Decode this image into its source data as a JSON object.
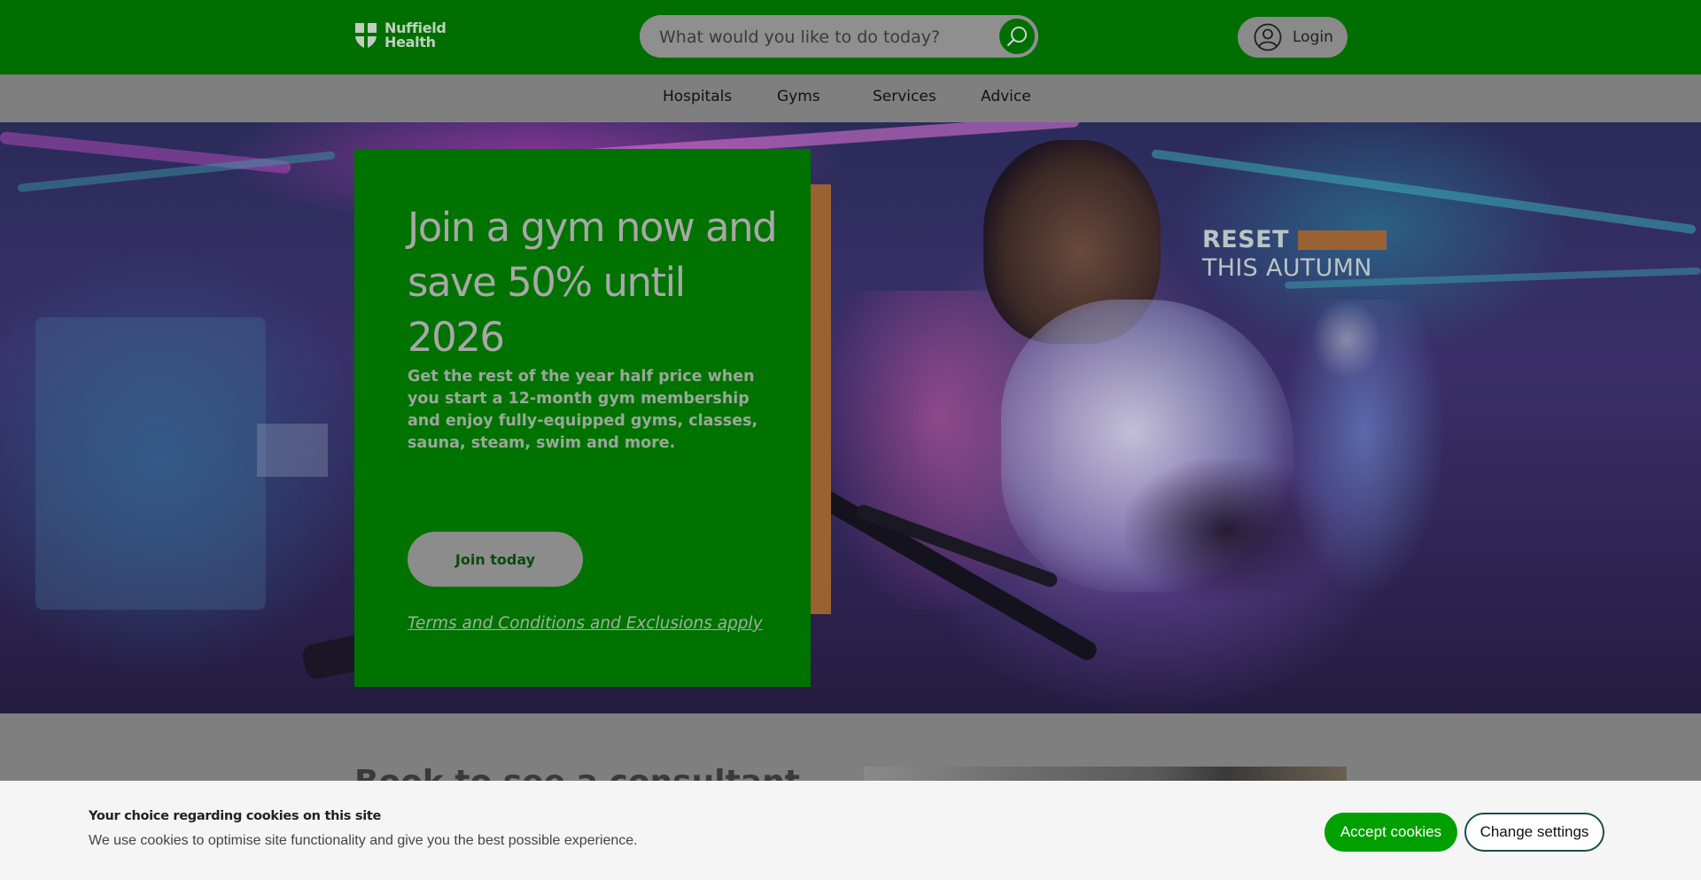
{
  "header": {
    "logo_text_line1": "Nuffield",
    "logo_text_line2": "Health",
    "search_placeholder": "What would you like to do today?",
    "login_label": "Login"
  },
  "nav": {
    "items": [
      {
        "label": "Hospitals"
      },
      {
        "label": "Gyms"
      },
      {
        "label": "Services"
      },
      {
        "label": "Advice"
      }
    ]
  },
  "hero": {
    "title": "Join a gym now and save 50% until 2026",
    "description": "Get the rest of the year half price when you start a 12-month gym membership and enjoy fully-equipped gyms, classes, sauna, steam, swim and more.",
    "cta_label": "Join today",
    "terms_link": "Terms and Conditions and Exclusions apply",
    "overlay_line1": "RESET",
    "overlay_line2": "THIS AUTUMN"
  },
  "below": {
    "heading": "Book to see a consultant"
  },
  "cookie_banner": {
    "title": "Your choice regarding cookies on this site",
    "text": "We use cookies to optimise site functionality and give you the best possible experience.",
    "accept_label": "Accept cookies",
    "settings_label": "Change settings"
  },
  "colors": {
    "brand_green": "#006e00",
    "accent_orange": "#9a6232",
    "accept_green": "#00a000"
  }
}
